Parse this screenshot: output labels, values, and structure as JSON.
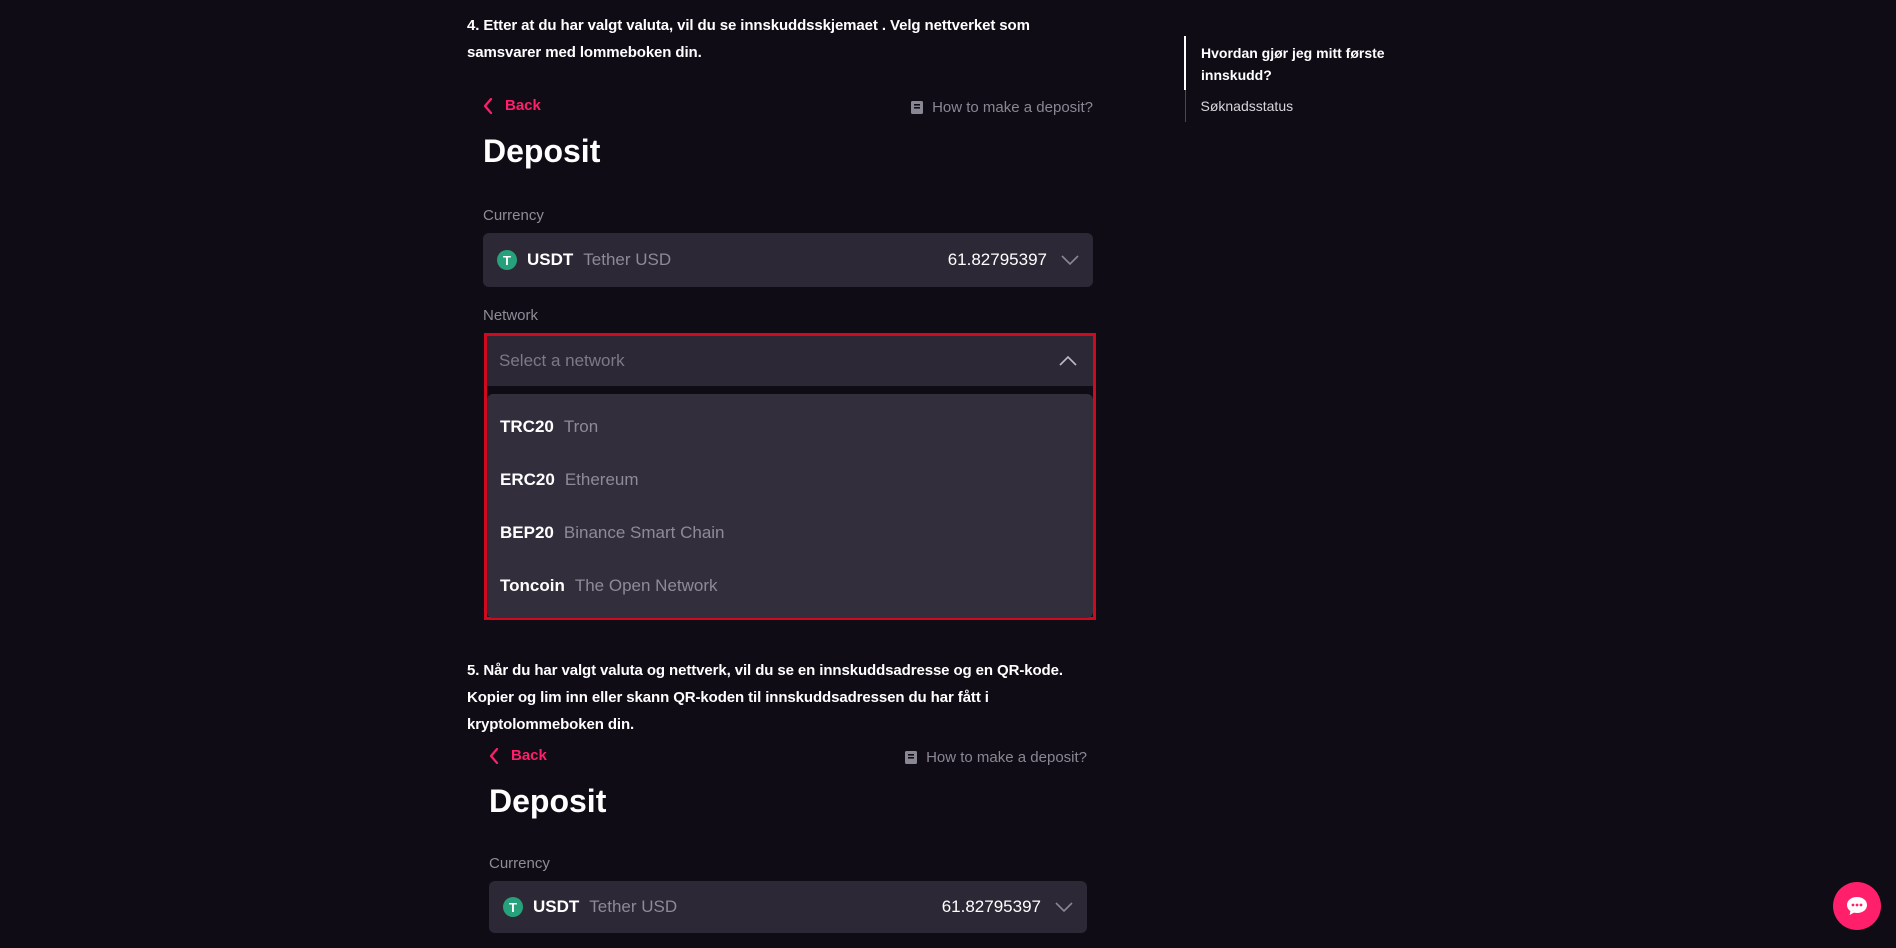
{
  "step4": {
    "text": "4. Etter at du har valgt valuta, vil du se innskuddsskjemaet . Velg nettverket som samsvarer med lommeboken din."
  },
  "step5": {
    "text": "5. Når du har valgt valuta og nettverk, vil du se en innskuddsadresse og en QR-kode. Kopier og lim inn eller skann QR-koden til innskuddsadressen du har fått i kryptolommeboken din."
  },
  "deposit1": {
    "back_label": "Back",
    "howto_label": "How to make a deposit?",
    "title": "Deposit",
    "currency_label": "Currency",
    "currency": {
      "icon_glyph": "T",
      "code": "USDT",
      "name": "Tether USD",
      "balance": "61.82795397"
    },
    "network_label": "Network",
    "network_placeholder": "Select a network",
    "networks": [
      {
        "code": "TRC20",
        "name": "Tron"
      },
      {
        "code": "ERC20",
        "name": "Ethereum"
      },
      {
        "code": "BEP20",
        "name": "Binance Smart Chain"
      },
      {
        "code": "Toncoin",
        "name": "The Open Network"
      }
    ]
  },
  "deposit2": {
    "back_label": "Back",
    "howto_label": "How to make a deposit?",
    "title": "Deposit",
    "currency_label": "Currency",
    "currency": {
      "icon_glyph": "T",
      "code": "USDT",
      "name": "Tether USD",
      "balance": "61.82795397"
    }
  },
  "toc": {
    "items": [
      {
        "label": "Hvordan gjør jeg mitt første innskudd?",
        "active": true
      },
      {
        "label": "Søknadsstatus",
        "active": false
      }
    ]
  },
  "colors": {
    "background": "#0f0c15",
    "accent": "#ff1f6b",
    "highlight_border": "#d0091f",
    "tether": "#26a17b"
  },
  "icons": {
    "back": "chevron-left-icon",
    "howto": "book-icon",
    "dropdown_closed": "chevron-down-icon",
    "dropdown_open": "chevron-up-icon",
    "chat": "chat-bubble-icon"
  }
}
